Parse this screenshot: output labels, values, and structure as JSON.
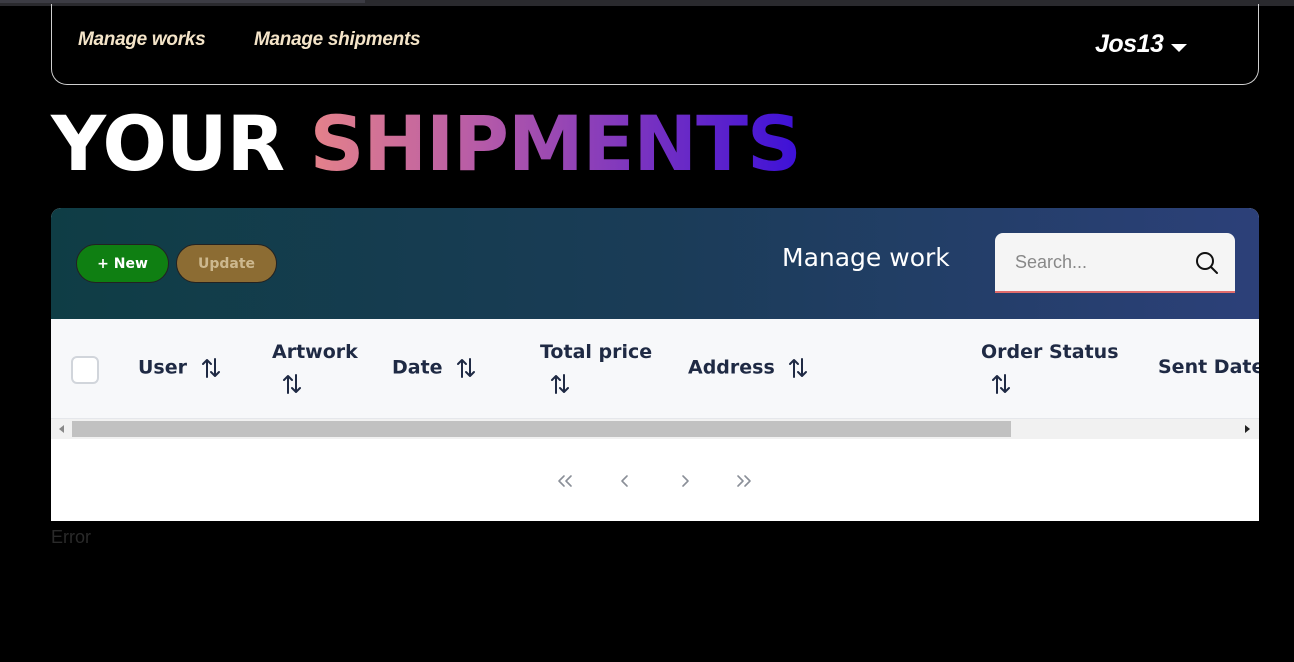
{
  "nav": {
    "links": [
      "Manage works",
      "Manage shipments"
    ],
    "user": "Jos13"
  },
  "page": {
    "title_part1": "YOUR",
    "title_part2": "SHIPMENTS"
  },
  "toolbar": {
    "new_label": "+ New",
    "update_label": "Update",
    "header_title": "Manage work",
    "search_placeholder": "Search..."
  },
  "table": {
    "columns": [
      {
        "label": "User",
        "sortable": true
      },
      {
        "label": "Artwork",
        "sortable": true
      },
      {
        "label": "Date",
        "sortable": true
      },
      {
        "label": "Total price",
        "sortable": true
      },
      {
        "label": "Address",
        "sortable": true
      },
      {
        "label": "Order Status",
        "sortable": true
      },
      {
        "label": "Sent Date",
        "sortable": true
      }
    ],
    "rows": []
  },
  "pager": {
    "icons": [
      "first-page-icon",
      "prev-page-icon",
      "next-page-icon",
      "last-page-icon"
    ]
  },
  "status": {
    "error": "Error"
  },
  "colors": {
    "background": "#000000",
    "nav_link": "#f4e4c8",
    "new_button": "#0f7f12",
    "update_button": "#8c6c33",
    "header_gradient_start": "#0f3d45",
    "header_gradient_end": "#2c4079",
    "title_gradient_start": "#e5828a",
    "title_gradient_end": "#3c10d8"
  }
}
